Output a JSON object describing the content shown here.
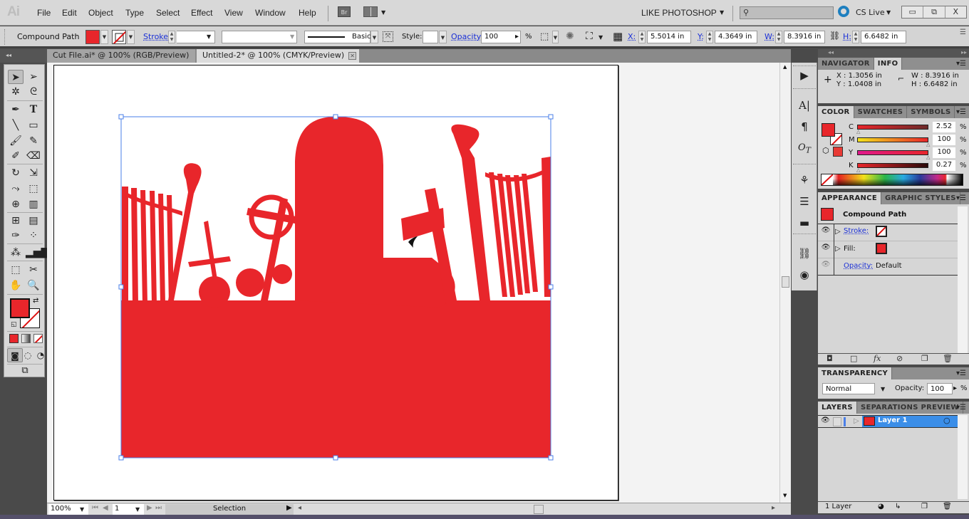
{
  "app": {
    "logo": "Ai"
  },
  "menu": [
    "File",
    "Edit",
    "Object",
    "Type",
    "Select",
    "Effect",
    "View",
    "Window",
    "Help"
  ],
  "bridge_label": "Br",
  "workspace": {
    "name": "LIKE PHOTOSHOP",
    "search_placeholder": ""
  },
  "cs_live": "CS Live",
  "window_controls": {
    "minimize": "▭",
    "restore": "⧉",
    "close": "X"
  },
  "control_bar": {
    "selection_type": "Compound Path",
    "fill_color": "#e8262b",
    "stroke_label": "Stroke:",
    "stroke_weight": "",
    "variable_width": "",
    "brush": "Basic",
    "style_label": "Style:",
    "opacity_label": "Opacity:",
    "opacity_value": "100",
    "opacity_unit": "%",
    "x_label": "X:",
    "x_value": "5.5014 in",
    "y_label": "Y:",
    "y_value": "4.3649 in",
    "w_label": "W:",
    "w_value": "8.3916 in",
    "h_label": "H:",
    "h_value": "6.6482 in"
  },
  "documents": [
    {
      "title": "Cut File.ai* @ 100% (RGB/Preview)",
      "active": false
    },
    {
      "title": "Untitled-2* @ 100% (CMYK/Preview)",
      "active": true
    }
  ],
  "status": {
    "zoom": "100%",
    "page": "1",
    "tool": "Selection"
  },
  "info_panel": {
    "tabs": [
      "NAVIGATOR",
      "INFO"
    ],
    "x": "X  : 1.3056 in",
    "y": "Y  : 1.0408 in",
    "w": "W : 8.3916 in",
    "h": "H  : 6.6482 in"
  },
  "color_panel": {
    "tabs": [
      "COLOR",
      "SWATCHES",
      "SYMBOLS"
    ],
    "channels": [
      {
        "label": "C",
        "value": "2.52",
        "unit": "%"
      },
      {
        "label": "M",
        "value": "100",
        "unit": "%"
      },
      {
        "label": "Y",
        "value": "100",
        "unit": "%"
      },
      {
        "label": "K",
        "value": "0.27",
        "unit": "%"
      }
    ],
    "fill_color": "#e8262b"
  },
  "appearance_panel": {
    "tabs": [
      "APPEARANCE",
      "GRAPHIC STYLES"
    ],
    "object": "Compound Path",
    "rows": [
      {
        "label": "Stroke:",
        "kind": "stroke"
      },
      {
        "label": "Fill:",
        "kind": "fill"
      },
      {
        "label": "Opacity:",
        "value": "Default",
        "kind": "opacity"
      }
    ]
  },
  "transparency_panel": {
    "tab": "TRANSPARENCY",
    "blend_mode": "Normal",
    "opacity_label": "Opacity:",
    "opacity_value": "100",
    "unit": "%"
  },
  "layers_panel": {
    "tabs": [
      "LAYERS",
      "SEPARATIONS PREVIEW"
    ],
    "layers": [
      {
        "name": "Layer 1"
      }
    ],
    "count": "1 Layer"
  },
  "colors": {
    "accent_red": "#e8262b",
    "selection_blue": "#4a7fe8",
    "layer_highlight": "#3b8ee8"
  }
}
